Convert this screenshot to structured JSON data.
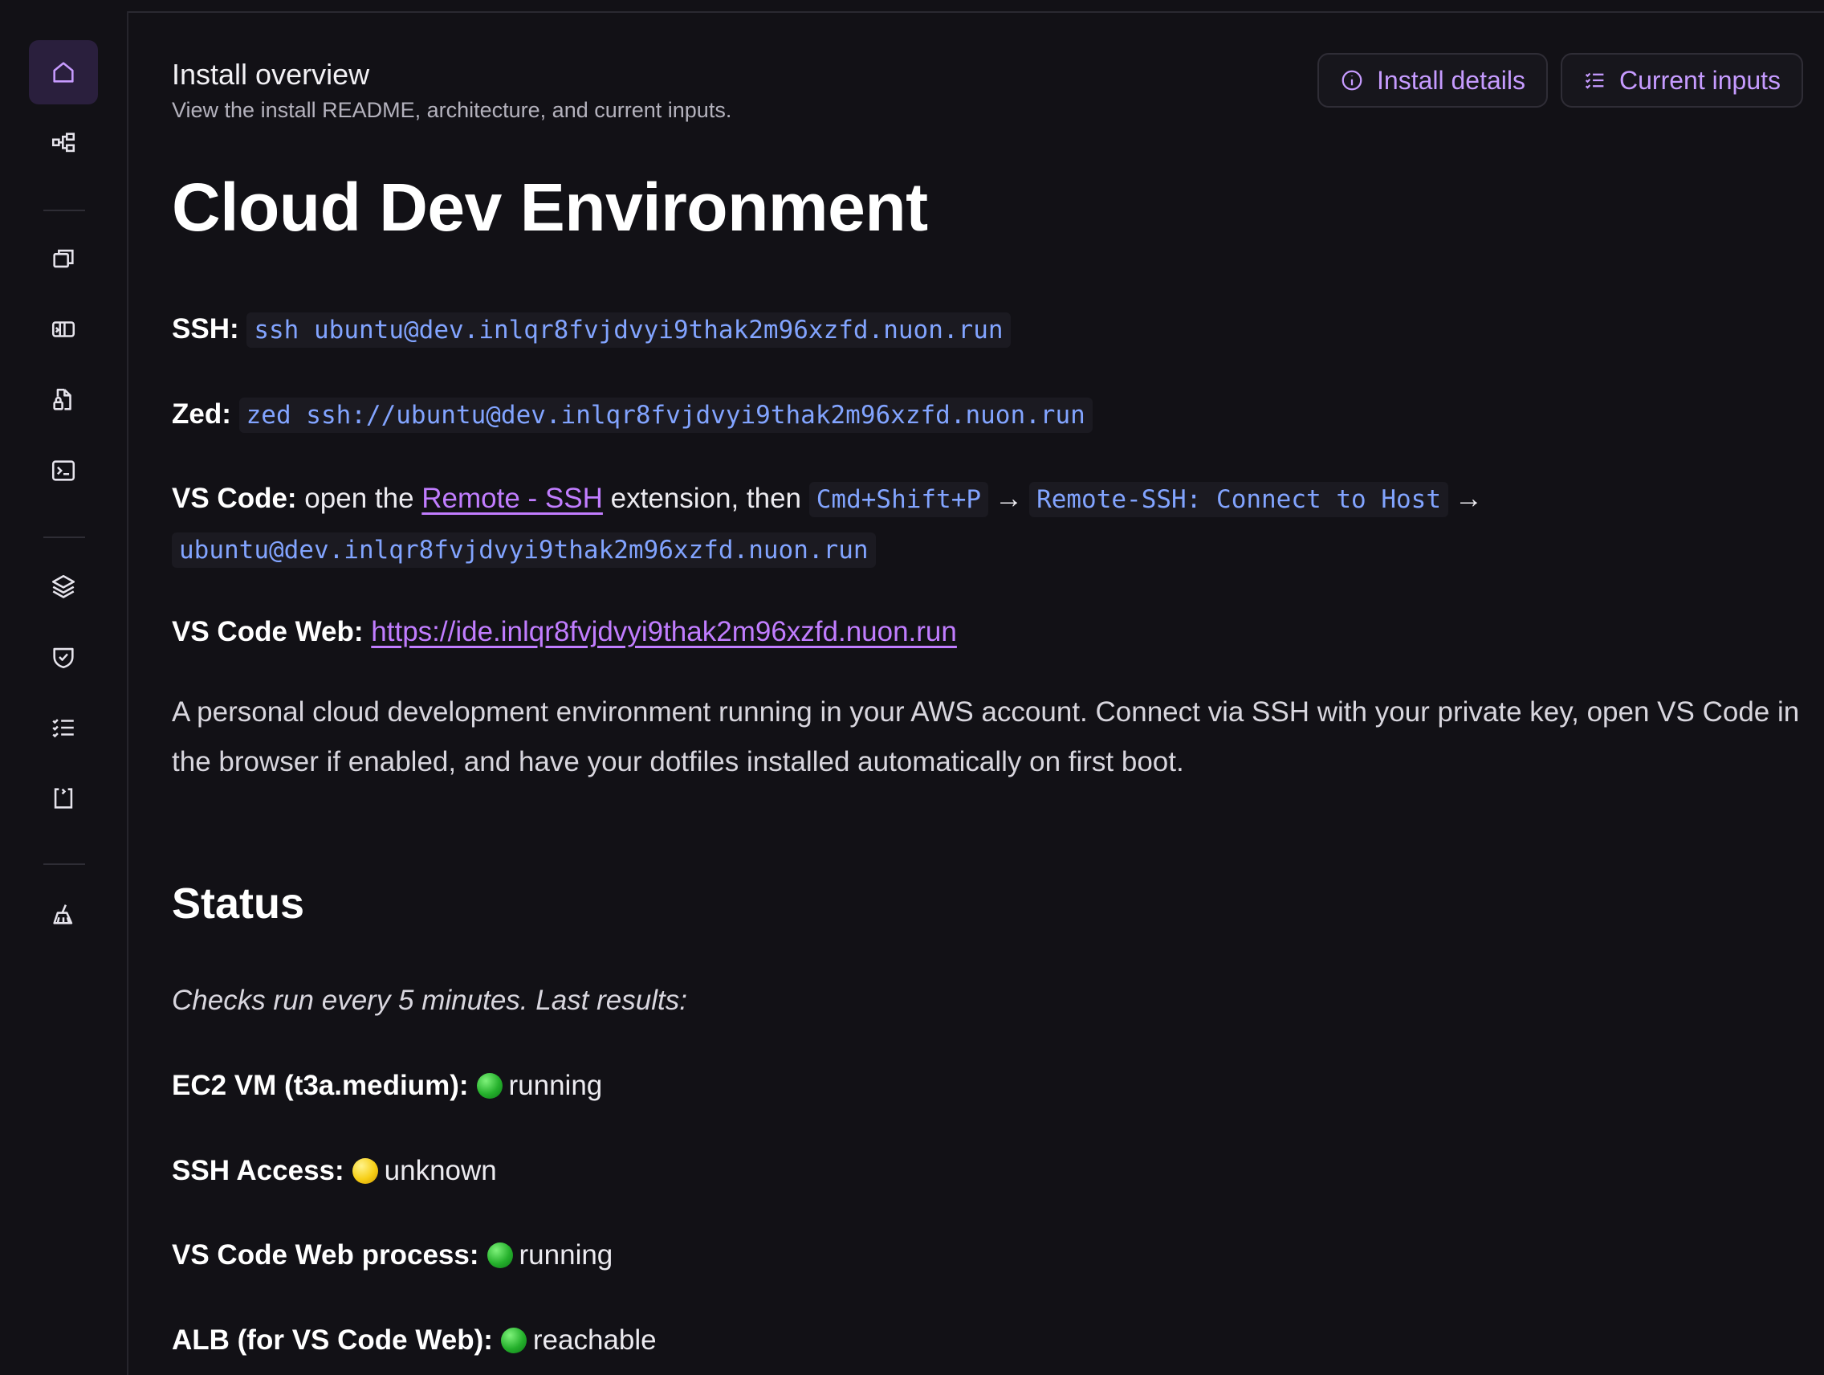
{
  "overview": {
    "title": "Install overview",
    "subtitle": "View the install README, architecture, and current inputs."
  },
  "header_buttons": {
    "install_details": "Install details",
    "current_inputs": "Current inputs"
  },
  "sidebar": {
    "items": [
      {
        "name": "home",
        "icon": "home-icon",
        "active": true
      },
      {
        "name": "components",
        "icon": "diagram-icon"
      },
      {
        "name": "runners",
        "icon": "windows-icon"
      },
      {
        "name": "sandbox",
        "icon": "box-icon"
      },
      {
        "name": "files",
        "icon": "file-lock-icon"
      },
      {
        "name": "terminal",
        "icon": "terminal-icon"
      },
      {
        "name": "stack",
        "icon": "layers-icon"
      },
      {
        "name": "policies",
        "icon": "shield-check-icon"
      },
      {
        "name": "checklist",
        "icon": "list-checks-icon"
      },
      {
        "name": "actions",
        "icon": "bracket-icon"
      },
      {
        "name": "settings",
        "icon": "broom-icon"
      }
    ]
  },
  "readme": {
    "heading": "Cloud Dev Environment",
    "ssh_label": "SSH:",
    "ssh_code": "ssh ubuntu@dev.inlqr8fvjdvyi9thak2m96xzfd.nuon.run",
    "zed_label": "Zed:",
    "zed_code": "zed ssh://ubuntu@dev.inlqr8fvjdvyi9thak2m96xzfd.nuon.run",
    "vscode_label": "VS Code:",
    "vscode_text1": " open the ",
    "vscode_link": "Remote - SSH",
    "vscode_text2": " extension, then ",
    "vscode_code1": "Cmd+Shift+P",
    "vscode_arrow": "→",
    "vscode_code2": "Remote-SSH: Connect to Host",
    "vscode_code3": "ubuntu@dev.inlqr8fvjdvyi9thak2m96xzfd.nuon.run",
    "vscode_web_label": "VS Code Web:",
    "vscode_web_link": "https://ide.inlqr8fvjdvyi9thak2m96xzfd.nuon.run",
    "description": "A personal cloud development environment running in your AWS account. Connect via SSH with your private key, open VS Code in the browser if enabled, and have your dotfiles installed automatically on first boot."
  },
  "status": {
    "heading": "Status",
    "note": "Checks run every 5 minutes. Last results:",
    "checks": [
      {
        "label": "EC2 VM (t3a.medium):",
        "value": "running",
        "color": "#25b02c"
      },
      {
        "label": "SSH Access:",
        "value": "unknown",
        "color": "#f7cf17"
      },
      {
        "label": "VS Code Web process:",
        "value": "running",
        "color": "#25b02c"
      },
      {
        "label": "ALB (for VS Code Web):",
        "value": "reachable",
        "color": "#25b02c"
      }
    ]
  },
  "colors": {
    "accent": "#c69bff",
    "link": "#c17dff",
    "code": "#82a4ff",
    "background": "#121116"
  }
}
